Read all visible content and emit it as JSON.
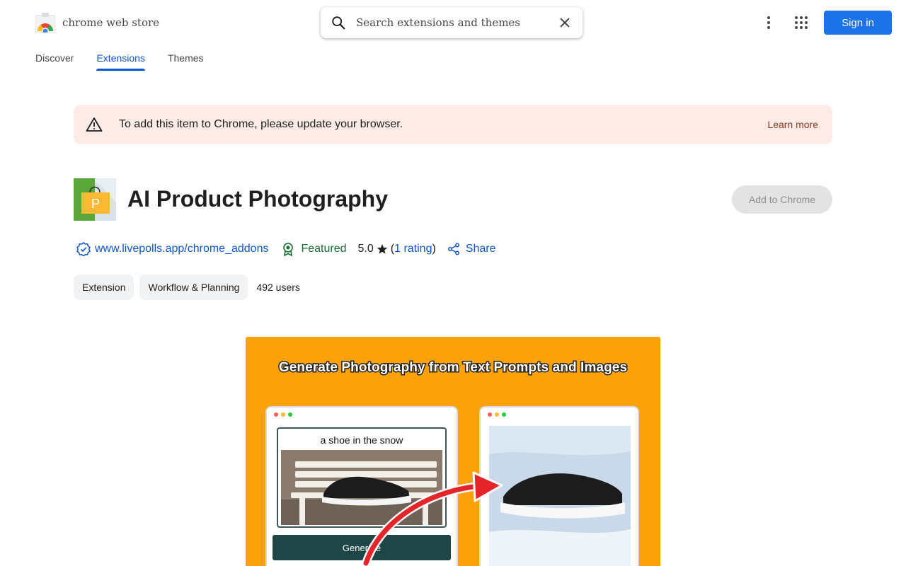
{
  "header": {
    "store_name": "chrome web store",
    "search_placeholder": "Search extensions and themes",
    "sign_in": "Sign in"
  },
  "tabs": [
    {
      "label": "Discover",
      "active": false
    },
    {
      "label": "Extensions",
      "active": true
    },
    {
      "label": "Themes",
      "active": false
    }
  ],
  "banner": {
    "message": "To add this item to Chrome, please update your browser.",
    "action": "Learn more"
  },
  "extension": {
    "title": "AI Product Photography",
    "add_button": "Add to Chrome",
    "developer_link": "www.livepolls.app/chrome_addons",
    "featured": "Featured",
    "rating": "5.0",
    "rating_count": "1 rating",
    "share": "Share",
    "chips": [
      "Extension",
      "Workflow & Planning"
    ],
    "users": "492 users"
  },
  "screenshot": {
    "headline": "Generate Photography from Text Prompts and Images",
    "prompt": "a shoe in the snow",
    "generate": "Generate"
  },
  "colors": {
    "accent": "#0b57d0",
    "sign_in_bg": "#1a73e8",
    "banner_bg": "#fcebe6",
    "featured_green": "#146c2e",
    "screenshot_bg": "#fba10a"
  }
}
